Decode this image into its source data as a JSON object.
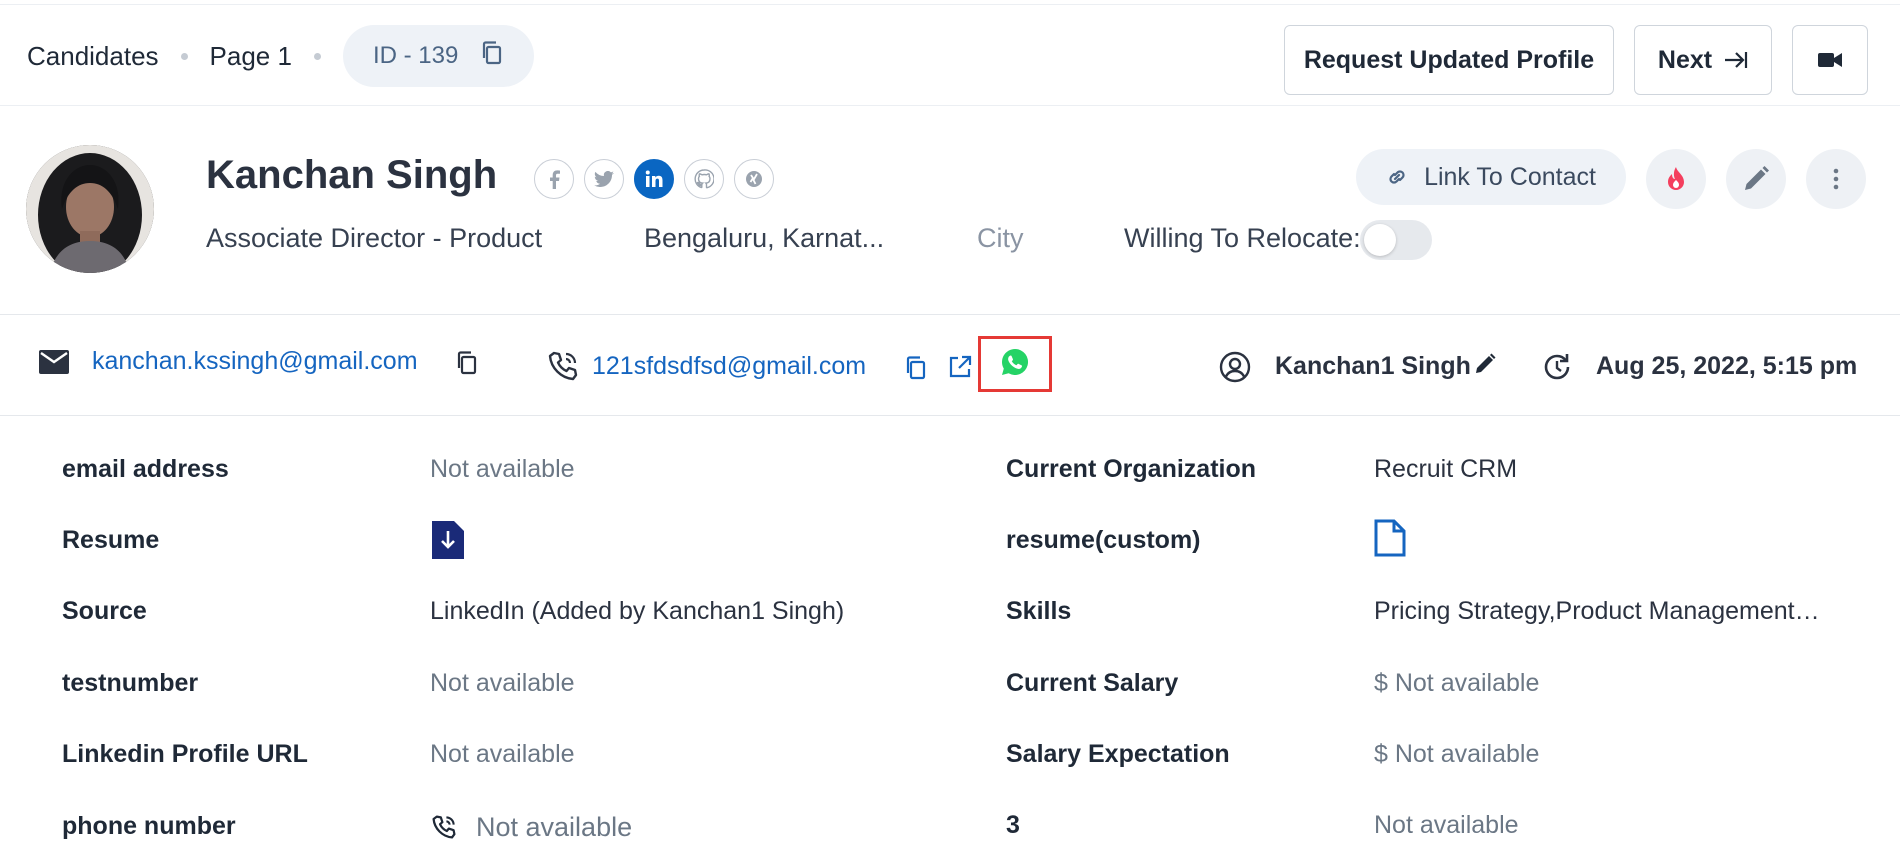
{
  "header": {
    "breadcrumbs": [
      "Candidates",
      "Page 1"
    ],
    "id_label": "ID - 139",
    "request_button": "Request Updated Profile",
    "next_button": "Next"
  },
  "profile": {
    "name": "Kanchan Singh",
    "title": "Associate Director - Product",
    "location": "Bengaluru, Karnat...",
    "city_placeholder": "City",
    "relocate_label": "Willing To Relocate:",
    "relocate_on": false,
    "link_to_contact": "Link To Contact",
    "socials": [
      "facebook-icon",
      "twitter-icon",
      "linkedin-icon",
      "github-icon",
      "xing-icon"
    ]
  },
  "contact": {
    "email": "kanchan.kssingh@gmail.com",
    "phone": "121sfdsdfsd@gmail.com",
    "owner": "Kanchan1 Singh",
    "updated": "Aug 25, 2022, 5:15 pm"
  },
  "fields": {
    "left": [
      {
        "label": "email address",
        "value": "Not available"
      },
      {
        "label": "Resume",
        "value": ""
      },
      {
        "label": "Source",
        "value": "LinkedIn (Added by Kanchan1 Singh)"
      },
      {
        "label": "testnumber",
        "value": "Not available"
      },
      {
        "label": "Linkedin Profile URL",
        "value": "Not available"
      },
      {
        "label": "phone number",
        "value": "Not available"
      }
    ],
    "right": [
      {
        "label": "Current Organization",
        "value": "Recruit CRM"
      },
      {
        "label": "resume(custom)",
        "value": ""
      },
      {
        "label": "Skills",
        "value": "Pricing Strategy,Product Management…"
      },
      {
        "label": "Current Salary",
        "value": "$ Not available"
      },
      {
        "label": "Salary Expectation",
        "value": "$ Not available"
      },
      {
        "label": "3",
        "value": "Not available"
      }
    ]
  },
  "colors": {
    "link_blue": "#1565c0",
    "linkedin": "#0a66c2",
    "whatsapp": "#25d366",
    "highlight": "#e53935",
    "hot": "#f43f5e"
  }
}
